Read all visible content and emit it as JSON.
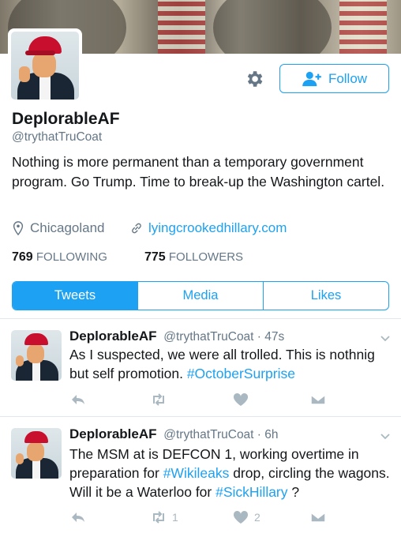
{
  "profile": {
    "name": "DeplorableAF",
    "handle": "@trythatTruCoat",
    "bio": "Nothing is more permanent than a temporary government program. Go Trump. Time to break-up the Washington cartel.",
    "location": "Chicagoland",
    "website": "lyingcrookedhillary.com",
    "following_count": "769",
    "following_label": "FOLLOWING",
    "followers_count": "775",
    "followers_label": "FOLLOWERS"
  },
  "actions": {
    "follow_label": "Follow",
    "settings_icon": "gear-icon"
  },
  "tabs": [
    {
      "label": "Tweets",
      "active": true
    },
    {
      "label": "Media",
      "active": false
    },
    {
      "label": "Likes",
      "active": false
    }
  ],
  "tweets": [
    {
      "name": "DeplorableAF",
      "handle_time": "@trythatTruCoat · 47s",
      "text_a": "As I suspected, we were all trolled. This is nothnig but self promotion. ",
      "hashtag_1": "#OctoberSurprise",
      "retweets": "",
      "likes": ""
    },
    {
      "name": "DeplorableAF",
      "handle_time": "@trythatTruCoat · 6h",
      "text_a": "The MSM at is DEFCON 1, working overtime in preparation for ",
      "hashtag_1": "#Wikileaks",
      "text_b": " drop, circling the wagons. Will it be a Waterloo for ",
      "hashtag_2": "#SickHillary",
      "text_c": " ?",
      "retweets": "1",
      "likes": "2"
    }
  ],
  "colors": {
    "accent": "#1da1f2",
    "text": "#14171a",
    "muted": "#657786",
    "icon": "#aab8c2"
  }
}
